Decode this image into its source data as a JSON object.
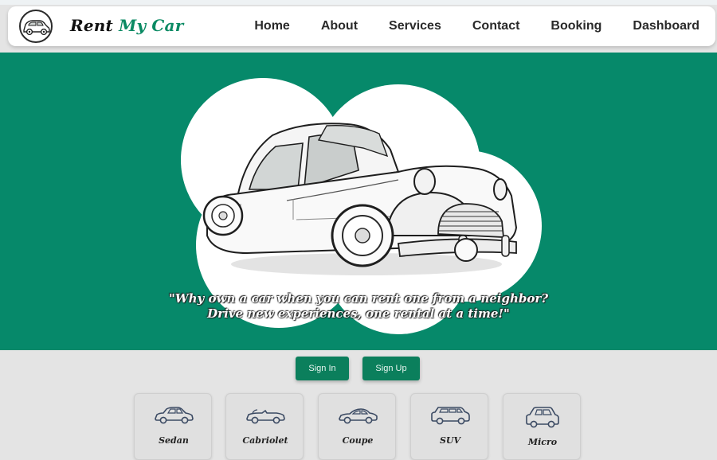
{
  "brand": {
    "part1": "Rent",
    "part2": "My Car"
  },
  "nav": [
    "Home",
    "About",
    "Services",
    "Contact",
    "Booking",
    "Dashboard"
  ],
  "hero": {
    "quote_line1": "\"Why own a car when you can rent one from a neighbor?",
    "quote_line2": "Drive new experiences, one rental at a time!\""
  },
  "auth": {
    "signin": "Sign In",
    "signup": "Sign Up"
  },
  "categories": [
    "Sedan",
    "Cabriolet",
    "Coupe",
    "SUV",
    "Micro"
  ],
  "colors": {
    "accent": "#06896a",
    "brand_green": "#0a8a63",
    "button": "#0b7f5c"
  },
  "icons": {
    "logo": "vintage-car-logo-icon",
    "hero": "vintage-car-illustration"
  }
}
